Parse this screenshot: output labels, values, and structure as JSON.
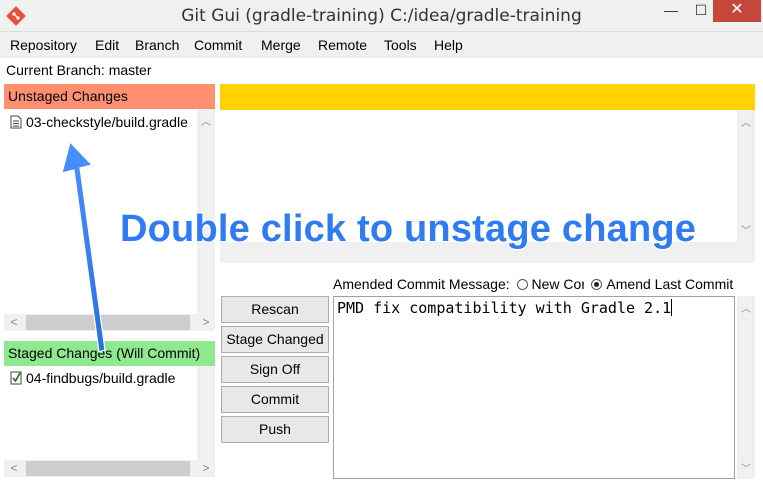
{
  "window": {
    "title": "Git Gui (gradle-training) C:/idea/gradle-training",
    "minimize": "—",
    "maximize": "☐",
    "close": "✕"
  },
  "menu": [
    "Repository",
    "Edit",
    "Branch",
    "Commit",
    "Merge",
    "Remote",
    "Tools",
    "Help"
  ],
  "current_branch": "Current Branch: master",
  "unstaged": {
    "header": "Unstaged Changes",
    "files": [
      "03-checkstyle/build.gradle"
    ]
  },
  "staged": {
    "header": "Staged Changes (Will Commit)",
    "files": [
      "04-findbugs/build.gradle"
    ]
  },
  "commit": {
    "label": "Amended Commit Message:",
    "option_new": "New Commit",
    "option_amend": "Amend Last Commit",
    "message": "PMD fix compatibility with Gradle 2.1"
  },
  "buttons": [
    "Rescan",
    "Stage Changed",
    "Sign Off",
    "Commit",
    "Push"
  ],
  "annotation": "Double click to unstage change",
  "colors": {
    "unstaged_header": "#ff8f71",
    "staged_header": "#8fe98f",
    "diff_header": "#ffd200",
    "annotation": "#2f7bf4"
  }
}
